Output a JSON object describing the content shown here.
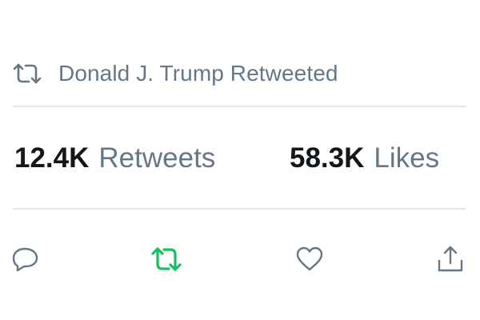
{
  "social_context": {
    "icon": "retweet-icon",
    "text": "Donald J. Trump Retweeted"
  },
  "stats": {
    "retweets_count": "12.4K",
    "retweets_label": "Retweets",
    "likes_count": "58.3K",
    "likes_label": "Likes"
  },
  "actions": {
    "reply_icon": "reply-icon",
    "retweet_icon": "retweet-icon",
    "retweet_active_color": "#17bf63",
    "like_icon": "heart-icon",
    "share_icon": "share-icon"
  },
  "colors": {
    "muted_text": "#657786",
    "primary_text": "#14171a",
    "divider": "#e1e8ed",
    "icon_default": "#657786"
  }
}
